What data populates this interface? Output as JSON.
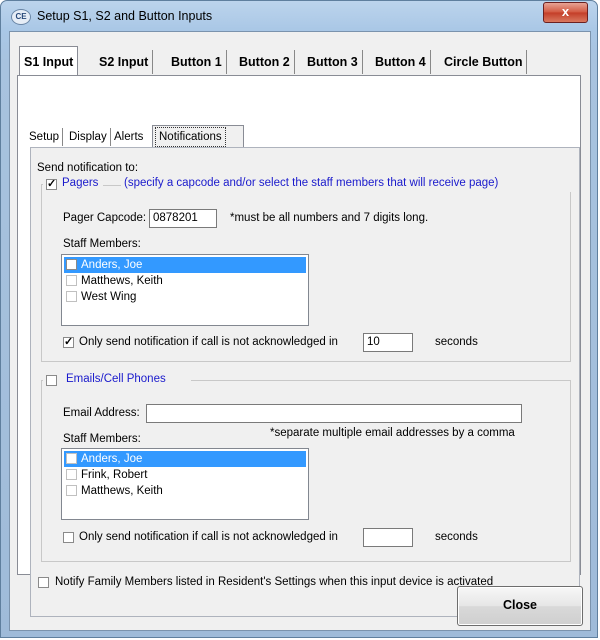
{
  "window": {
    "title": "Setup S1, S2 and Button Inputs",
    "close_glyph": "x",
    "app_icon_text": "CE"
  },
  "outer_tabs": [
    {
      "label": "S1 Input"
    },
    {
      "label": "S2 Input"
    },
    {
      "label": "Button 1"
    },
    {
      "label": "Button 2"
    },
    {
      "label": "Button 3"
    },
    {
      "label": "Button 4"
    },
    {
      "label": "Circle Button"
    }
  ],
  "inner_tabs": [
    {
      "label": "Setup"
    },
    {
      "label": "Display"
    },
    {
      "label": "Alerts"
    },
    {
      "label": "Notifications"
    }
  ],
  "notifications": {
    "send_to_label": "Send notification to:",
    "pagers": {
      "label": "Pagers",
      "hint": "(specify a capcode and/or select the staff members that will receive page)",
      "checked": true,
      "capcode_label": "Pager Capcode:",
      "capcode_value": "0878201",
      "capcode_note": "*must be all numbers and 7 digits long.",
      "staff_label": "Staff Members:",
      "staff": [
        {
          "name": "Anders, Joe",
          "checked": true,
          "selected": true
        },
        {
          "name": "Matthews, Keith",
          "checked": false,
          "selected": false
        },
        {
          "name": "West Wing",
          "checked": false,
          "selected": false
        }
      ],
      "ack_label": "Only send notification if call is not acknowledged in",
      "ack_checked": true,
      "ack_value": "10",
      "ack_unit": "seconds"
    },
    "emails": {
      "label": "Emails/Cell Phones",
      "checked": false,
      "email_label": "Email Address:",
      "email_value": "",
      "email_note": "*separate multiple email addresses by a comma",
      "staff_label": "Staff Members:",
      "staff": [
        {
          "name": "Anders, Joe",
          "checked": false,
          "selected": true
        },
        {
          "name": "Frink, Robert",
          "checked": false,
          "selected": false
        },
        {
          "name": "Matthews, Keith",
          "checked": false,
          "selected": false
        }
      ],
      "ack_label": "Only send notification if call is not acknowledged in",
      "ack_checked": false,
      "ack_value": "",
      "ack_unit": "seconds"
    },
    "family_label": "Notify Family Members listed in Resident's Settings when this input device is activated",
    "family_checked": false
  },
  "footer": {
    "close_label": "Close"
  },
  "check_glyph": "✓"
}
